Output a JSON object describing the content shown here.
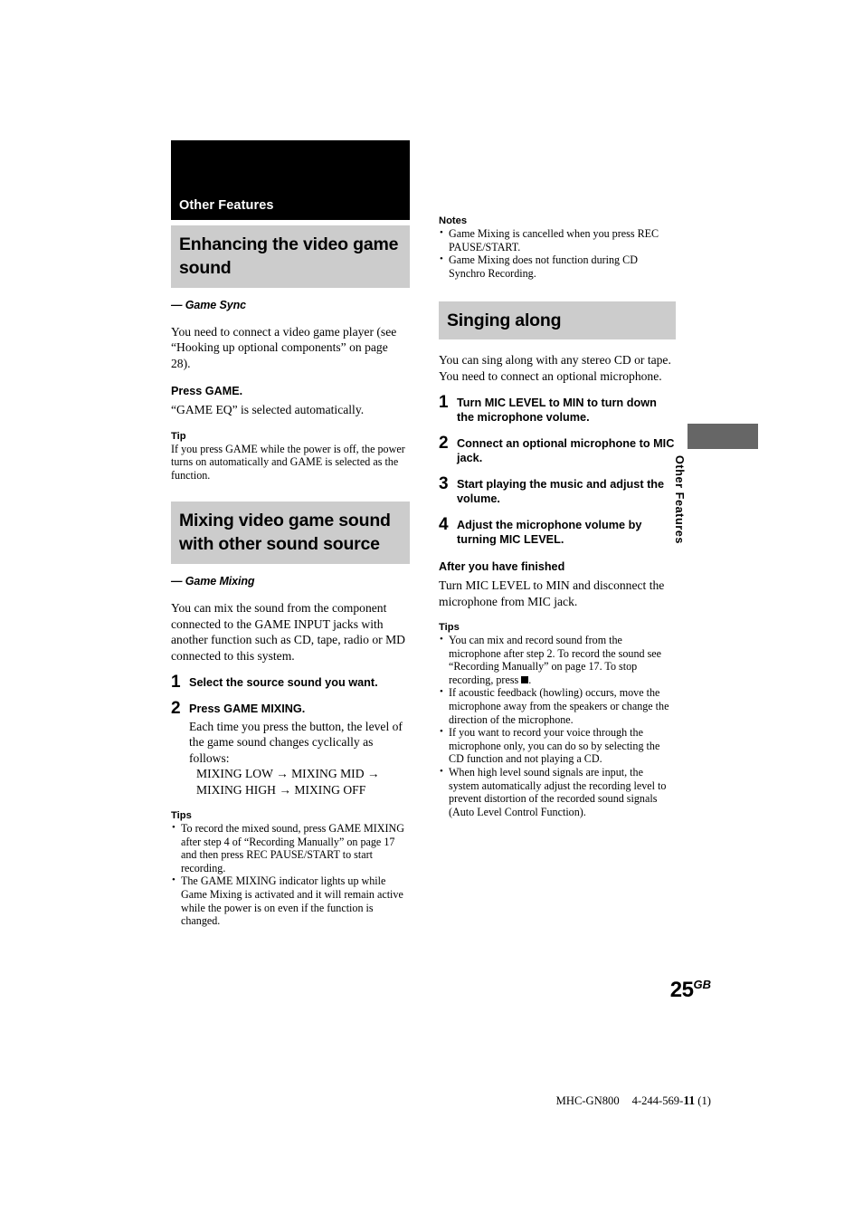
{
  "chapter": {
    "banner_title": "Other Features"
  },
  "left_column": {
    "section1": {
      "heading": "Enhancing the video game sound",
      "subheading": "— Game Sync",
      "intro": "You need to connect a video game player (see “Hooking up optional components” on page 28).",
      "press_heading": "Press GAME.",
      "press_body": "“GAME EQ” is selected automatically.",
      "tip_heading": "Tip",
      "tip_body": "If you press GAME while the power is off, the power turns on automatically and GAME is selected as the function."
    },
    "section2": {
      "heading": "Mixing video game sound with other sound source",
      "subheading": "— Game Mixing",
      "intro": "You can mix the sound from the component connected to the GAME INPUT jacks with another function such as CD, tape, radio or MD connected to this system.",
      "steps": [
        {
          "num": "1",
          "title": "Select the source sound you want.",
          "body": "",
          "cycle": ""
        },
        {
          "num": "2",
          "title": "Press GAME MIXING.",
          "body": "Each time you press the button, the level of the game sound changes cyclically as follows:",
          "cycle_line1": "MIXING LOW → MIXING MID →",
          "cycle_line2": "MIXING HIGH → MIXING OFF"
        }
      ],
      "tips_heading": "Tips",
      "tips": [
        "To record the mixed sound, press GAME MIXING after step 4 of “Recording Manually” on page 17 and then press REC PAUSE/START to start recording.",
        "The GAME MIXING indicator lights up while Game Mixing is activated and it will remain active while the power is on even if the function is changed."
      ]
    }
  },
  "right_column": {
    "notes_heading": "Notes",
    "notes": [
      "Game Mixing is cancelled when you press REC PAUSE/START.",
      "Game Mixing does not function during CD Synchro Recording."
    ],
    "section3": {
      "heading": "Singing along",
      "intro": "You can sing along with any stereo CD or tape. You need to connect an optional microphone.",
      "steps": [
        {
          "num": "1",
          "title": "Turn MIC LEVEL to MIN to turn down the microphone volume."
        },
        {
          "num": "2",
          "title": "Connect an optional microphone to MIC jack."
        },
        {
          "num": "3",
          "title": "Start playing the music and adjust the volume."
        },
        {
          "num": "4",
          "title": "Adjust the microphone volume by turning MIC LEVEL."
        }
      ],
      "after_heading": "After you have finished",
      "after_body": "Turn MIC LEVEL to MIN and disconnect the microphone from MIC jack.",
      "tips_heading": "Tips",
      "tip1_part1": "You can mix and record sound from the microphone after step 2. To record the sound see “Recording Manually” on page 17. To stop recording, press",
      "tip1_part2": ".",
      "tips_rest": [
        "If acoustic feedback (howling) occurs, move the microphone away from the speakers or change the direction of the microphone.",
        "If you want to record your voice through the microphone only, you can do so by selecting the CD function and not playing a CD.",
        "When high level sound signals are input, the system automatically adjust the recording level to prevent distortion of the recorded sound signals (Auto Level Control Function)."
      ]
    }
  },
  "thumb_tab": {
    "label": "Other Features"
  },
  "page_number": {
    "number": "25",
    "suffix": "GB"
  },
  "footer": {
    "model": "MHC-GN800",
    "part_prefix": "4-244-569-",
    "revision": "11",
    "edition": " (1)"
  },
  "colors": {
    "banner_black": "#000000",
    "section_gray": "#cccccc",
    "tab_gray": "#666666"
  }
}
